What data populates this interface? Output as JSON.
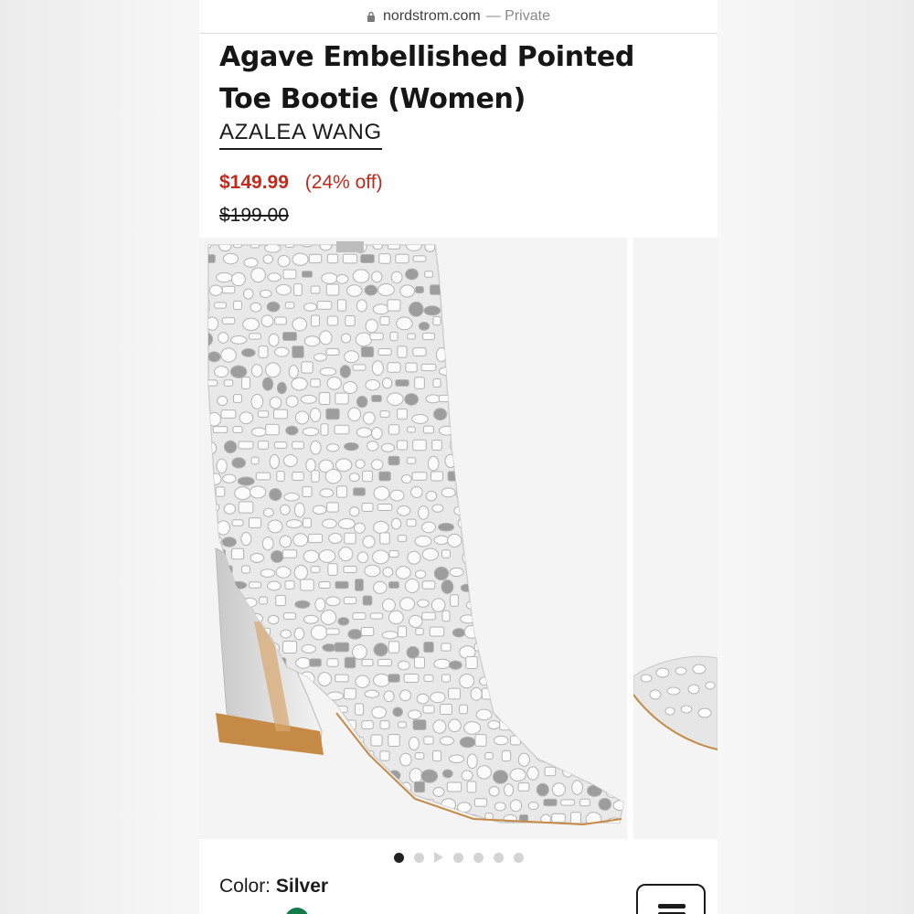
{
  "browser": {
    "domain": "nordstrom.com",
    "mode": "— Private"
  },
  "product": {
    "title": "Agave Embellished Pointed Toe Bootie (Women)",
    "brand": "AZALEA WANG",
    "sale_price": "$149.99",
    "discount": "(24% off)",
    "original_price": "$199.00",
    "color_label": "Color:",
    "color_value": "Silver"
  },
  "gallery": {
    "image_count": 7,
    "active_index": 0,
    "main_image": "clear-crystal-embellished-pointed-toe-boot",
    "next_image": "crystal-boot-side-view"
  },
  "colors": {
    "sale": "#c2291c",
    "swatch": "#137a4c"
  }
}
